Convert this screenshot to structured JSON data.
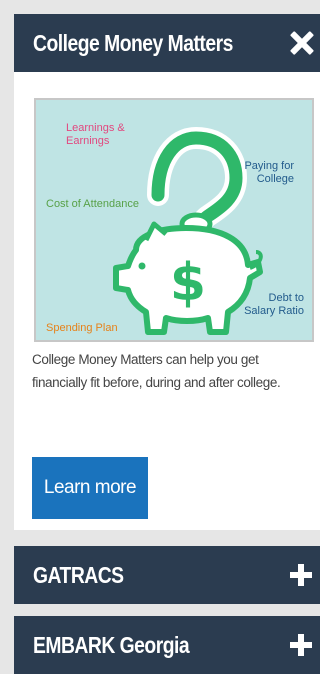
{
  "panel": {
    "title": "College Money Matters",
    "close_icon": "close-icon",
    "image": {
      "labels": {
        "learnings_line1": "Learnings &",
        "learnings_line2": "Earnings",
        "cost": "Cost of Attendance",
        "paying_line1": "Paying for",
        "paying_line2": "College",
        "debt_line1": "Debt to",
        "debt_line2": "Salary Ratio",
        "spending": "Spending Plan"
      },
      "icon": "piggy-bank-question-icon"
    },
    "description": "College Money Matters can help you get financially fit before, during and after college.",
    "button_label": "Learn more"
  },
  "accordions": [
    {
      "title": "GATRACS",
      "icon": "plus-icon"
    },
    {
      "title": "EMBARK Georgia",
      "icon": "plus-icon"
    }
  ],
  "colors": {
    "header_bg": "#2b3c50",
    "button_bg": "#1a73bd",
    "image_bg": "#bfe4e4",
    "accent_green": "#2fb86a"
  }
}
